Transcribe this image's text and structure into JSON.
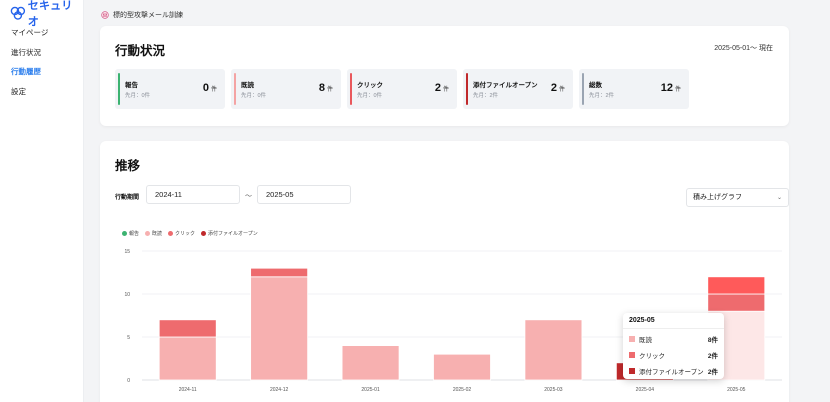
{
  "brand": {
    "name": "セキュリオ"
  },
  "sidebar": {
    "items": [
      {
        "label": "マイページ",
        "active": false
      },
      {
        "label": "進行状況",
        "active": false
      },
      {
        "label": "行動履歴",
        "active": true
      },
      {
        "label": "設定",
        "active": false
      }
    ]
  },
  "breadcrumb": {
    "icon": "phishing-icon",
    "label": "標的型攻撃メール訓練"
  },
  "status": {
    "title": "行動状況",
    "period": "2025-05-01～ 現在",
    "stats": [
      {
        "label": "報告",
        "sub": "先月：0件",
        "value": "0",
        "unit": "件",
        "color": "#3cb371"
      },
      {
        "label": "既読",
        "sub": "先月：0件",
        "value": "8",
        "unit": "件",
        "color": "#f4a3a3"
      },
      {
        "label": "クリック",
        "sub": "先月：0件",
        "value": "2",
        "unit": "件",
        "color": "#e9585c"
      },
      {
        "label": "添付ファイルオープン",
        "sub": "先月：2件",
        "value": "2",
        "unit": "件",
        "color": "#c0292b"
      },
      {
        "label": "総数",
        "sub": "先月：2件",
        "value": "12",
        "unit": "件",
        "color": "#9aa4b2"
      }
    ]
  },
  "trend": {
    "title": "推移",
    "range_label": "行動期間",
    "from": "2024-11",
    "separator": "～",
    "to": "2025-05",
    "chart_type_select": "積み上げグラフ"
  },
  "colors": {
    "report": "#3cb371",
    "read": "#f7b0b0",
    "click": "#ee6b6e",
    "attach": "#c0292b",
    "accent": "#2f80ed"
  },
  "chart_data": {
    "type": "bar",
    "stacked": true,
    "categories": [
      "2024-11",
      "2024-12",
      "2025-01",
      "2025-02",
      "2025-03",
      "2025-04",
      "2025-05"
    ],
    "series": [
      {
        "name": "報告",
        "values": [
          0,
          0,
          0,
          0,
          0,
          0,
          0
        ]
      },
      {
        "name": "既読",
        "values": [
          5,
          12,
          4,
          3,
          7,
          0,
          8
        ]
      },
      {
        "name": "クリック",
        "values": [
          2,
          1,
          0,
          0,
          0,
          0,
          2
        ]
      },
      {
        "name": "添付ファイルオープン",
        "values": [
          0,
          0,
          0,
          0,
          0,
          2,
          2
        ]
      }
    ],
    "ylim": [
      0,
      15
    ],
    "yticks": [
      0,
      5,
      10,
      15
    ],
    "grid": true,
    "legend": "top-left"
  },
  "tooltip": {
    "title": "2025-05",
    "rows": [
      {
        "name": "既読",
        "value": "8件"
      },
      {
        "name": "クリック",
        "value": "2件"
      },
      {
        "name": "添付ファイルオープン",
        "value": "2件"
      }
    ]
  }
}
